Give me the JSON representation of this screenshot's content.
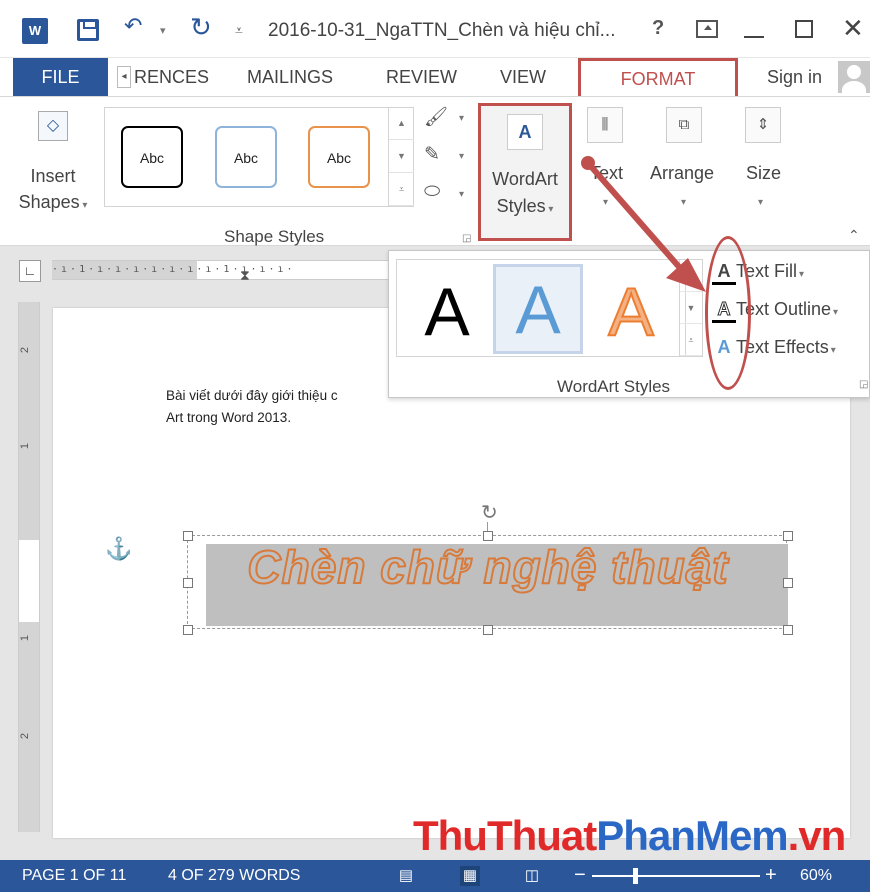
{
  "titlebar": {
    "word_icon": "W",
    "doc_title": "2016-10-31_NgaTTN_Chèn và hiệu chỉ...",
    "help": "?",
    "icons": [
      "word-icon",
      "save-icon",
      "undo-icon",
      "redo-icon",
      "customize-qat-icon",
      "help-icon",
      "ribbon-options-icon",
      "minimize-icon",
      "maximize-icon",
      "close-icon"
    ]
  },
  "tabs": {
    "file": "FILE",
    "references": "RENCES",
    "mailings": "MAILINGS",
    "review": "REVIEW",
    "view": "VIEW",
    "format": "FORMAT",
    "sign_in": "Sign in"
  },
  "ribbon": {
    "insert_shapes": "Insert Shapes",
    "insert_shapes_line1": "Insert",
    "insert_shapes_line2": "Shapes",
    "style_samples": [
      "Abc",
      "Abc",
      "Abc"
    ],
    "shape_styles_label": "Shape Styles",
    "wordart_styles_line1": "WordArt",
    "wordart_styles_line2": "Styles",
    "text_label": "Text",
    "arrange_label": "Arrange",
    "size_label": "Size"
  },
  "wordart_panel": {
    "samples": [
      "A",
      "A",
      "A"
    ],
    "text_fill": "Text Fill",
    "text_outline": "Text Outline",
    "text_effects": "Text Effects",
    "group_label": "WordArt Styles"
  },
  "document": {
    "body_line1": "Bài viết dưới đây giới thiệu c",
    "body_line2": "Art trong Word 2013.",
    "wordart_text": "Chèn chữ nghệ thuật"
  },
  "ruler": {
    "h_numbers": [
      "1",
      "1"
    ],
    "v_numbers": [
      "2",
      "1",
      "1",
      "2"
    ]
  },
  "statusbar": {
    "page": "PAGE 1 OF 11",
    "words": "4 OF 279 WORDS",
    "zoom": "60%",
    "zoom_percent": 60
  },
  "watermark": {
    "part1": "ThuThuat",
    "part2": "PhanMem",
    "part3": ".vn"
  },
  "colors": {
    "accent": "#2b579a",
    "highlight": "#c0504d",
    "wordart_fill": "#bfbfbf",
    "wordart_outline": "#d87a3a"
  }
}
